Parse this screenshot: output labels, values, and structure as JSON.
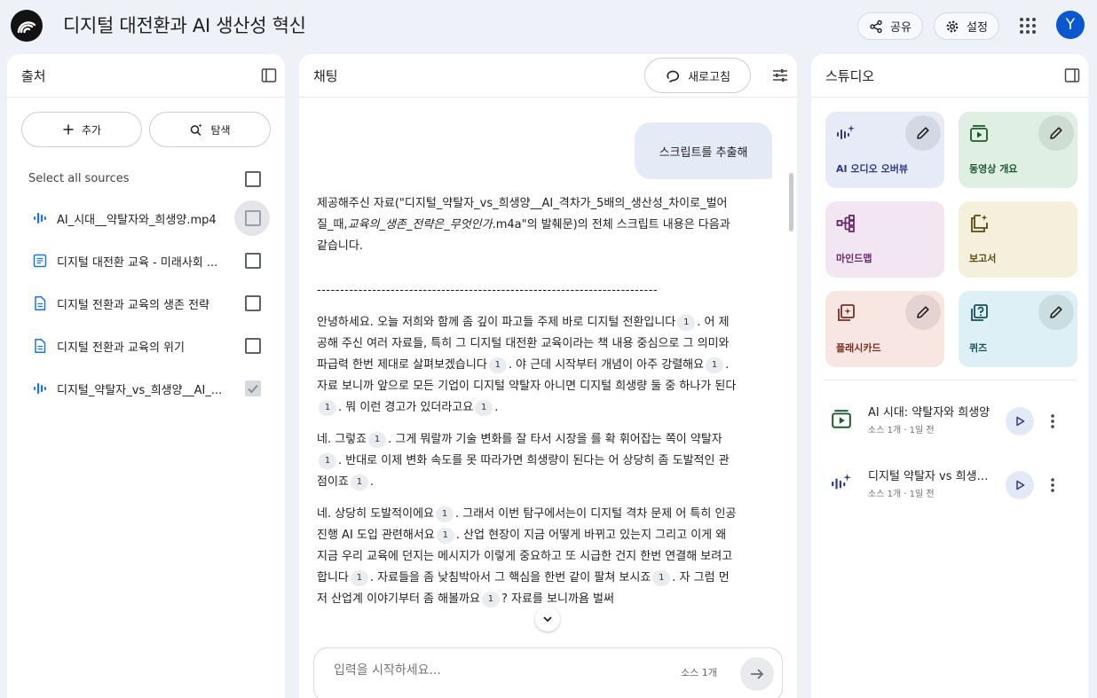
{
  "header": {
    "title": "디지털 대전환과 AI 생산성 혁신",
    "share_label": "공유",
    "settings_label": "설정",
    "avatar_initial": "Y",
    "accent_color": "#0b57d0"
  },
  "sources": {
    "title": "출처",
    "add_label": "추가",
    "explore_label": "탐색",
    "select_all": "Select all sources",
    "items": [
      {
        "label": "AI_시대__약탈자와_희생양.mp4",
        "icon": "audio-icon",
        "checked": false
      },
      {
        "label": "디지털 대전환 교육 - 미래사회 ...",
        "icon": "doc-icon",
        "checked": false
      },
      {
        "label": "디지털 전환과 교육의 생존 전략",
        "icon": "file-icon",
        "checked": false
      },
      {
        "label": "디지털 전환과 교육의 위기",
        "icon": "file-icon",
        "checked": false
      },
      {
        "label": "디지털_약탈자_vs_희생양__AI_...",
        "icon": "audio-icon",
        "checked": true
      }
    ]
  },
  "chat": {
    "title": "채팅",
    "refresh_label": "새로고침",
    "user_message": "스크립트를 추출해",
    "answer_intro_a": "제공해주신 자료(\"디지털_약탈자_vs_희생양__AI_격차가_5배의_생산성_차이로_벌어질_때,",
    "answer_intro_b": "교육의_생존_전략은_무엇인가",
    "answer_intro_c": ".m4a\"의 발췌문)의 전체 스크립트 내용은 다음과 같습니다.",
    "separator": "--------------------------------------------------------------------------",
    "cite": "1",
    "p1": [
      "안녕하세요. 오늘 저희와 함께 좀 깊이 파고들 주제 바로 디지털 전환입니다",
      ". 어 제공해 주신 여러 자료들, 특히 그 디지털 대전환 교육이라는 책 내용 중심으로 그 의미와 파급력 한번 제대로 살펴보겠습니다",
      ". 야 근데 시작부터 개념이 아주 강렬해요",
      ". 자료 보니까 앞으로 모든 기업이 디지털 약탈자 아니면 디지털 희생량 둘 중 하나가 된다",
      ". 뭐 이런 경고가 있더라고요",
      "."
    ],
    "p2": [
      "네. 그렇죠",
      ". 그게 뭐랄까 기술 변화를 잘 타서 시장을 를 확 휘어잡는 쪽이 약탈자",
      ". 반대로 이제 변화 속도를 못 따라가면 희생량이 된다는 어 상당히 좀 도발적인 관점이죠",
      "."
    ],
    "p3": [
      "네. 상당히 도발적이에요",
      ". 그래서 이번 탐구에서는이 디지털 격차 문제 어 특히 인공진행 AI 도입 관련해서요",
      ". 산업 현장이 지금 어떻게 바뀌고 있는지 그리고 이게 왜 지금 우리 교육에 던지는 메시지가 이렇게 중요하고 또 시급한 건지 한번 연결해 보려고 합니다",
      ". 자료들을 좀 낮침박아서 그 핵심을 한번 같이 팔쳐 보시죠",
      ". 자 그럼 먼저 산업계 이야기부터 좀 해볼까요",
      "? 자료를 보니까욤 벌써"
    ],
    "input_placeholder": "입력을 시작하세요...",
    "source_count": "소스 1개"
  },
  "studio": {
    "title": "스튜디오",
    "tiles": [
      {
        "label": "AI 오디오 오버뷰",
        "bg": "#e7ebf8",
        "fg": "#2b3a8a"
      },
      {
        "label": "동영상 개요",
        "bg": "#e0efe3",
        "fg": "#1e5a2e"
      },
      {
        "label": "마인드맵",
        "bg": "#f1e6f1",
        "fg": "#6a2a6a"
      },
      {
        "label": "보고서",
        "bg": "#f4f0dc",
        "fg": "#5a4a15"
      },
      {
        "label": "플래시카드",
        "bg": "#f8e6e3",
        "fg": "#7a2e22"
      },
      {
        "label": "퀴즈",
        "bg": "#dcf0f5",
        "fg": "#164e5a"
      }
    ],
    "notes": [
      {
        "title": "AI 시대: 약탈자와 희생양",
        "meta": "소스 1개 · 1일 전",
        "icon": "video-icon"
      },
      {
        "title": "디지털 약탈자 vs 희생양: AI",
        "meta": "소스 1개 · 1일 전",
        "icon": "audio-sparkle-icon"
      }
    ]
  }
}
